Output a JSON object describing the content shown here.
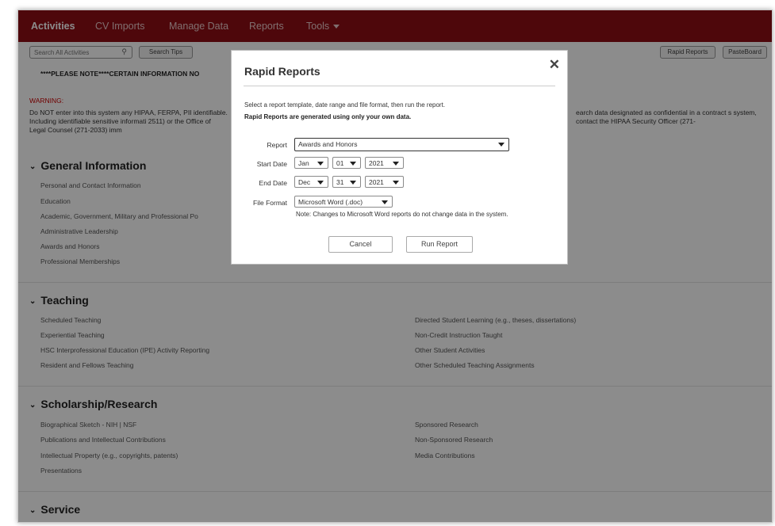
{
  "nav": {
    "items": [
      {
        "label": "Activities",
        "active": true
      },
      {
        "label": "CV Imports",
        "active": false
      },
      {
        "label": "Manage Data",
        "active": false
      },
      {
        "label": "Reports",
        "active": false
      },
      {
        "label": "Tools",
        "active": false
      }
    ]
  },
  "toolbar": {
    "search_placeholder": "Search All Activities",
    "search_tips": "Search Tips",
    "rapid_reports": "Rapid Reports",
    "pasteboard": "PasteBoard"
  },
  "notice": "****PLEASE NOTE****CERTAIN INFORMATION NO",
  "warning": {
    "label": "WARNING:",
    "text_left": "Do NOT enter into this system any HIPAA, FERPA, PII identifiable. Including identifiable sensitive informati 2511) or the Office of Legal Counsel (271-2033) imm",
    "text_right": "earch data designated as confidential in a contract s system, contact the HIPAA Security Officer (271-"
  },
  "sections": {
    "general": {
      "title": "General Information",
      "links": [
        "Personal and Contact Information",
        "Education",
        "Academic, Government, Military and Professional Po",
        "Administrative Leadership",
        "Awards and Honors",
        "Professional Memberships"
      ]
    },
    "teaching": {
      "title": "Teaching",
      "left": [
        "Scheduled Teaching",
        "Experiential Teaching",
        "HSC Interprofessional Education (IPE) Activity Reporting",
        "Resident and Fellows Teaching"
      ],
      "right": [
        "Directed Student Learning (e.g., theses, dissertations)",
        "Non-Credit Instruction Taught",
        "Other Student Activities",
        "Other Scheduled Teaching Assignments"
      ]
    },
    "scholarship": {
      "title": "Scholarship/Research",
      "left": [
        "Biographical Sketch - NIH | NSF",
        "Publications and Intellectual Contributions",
        "Intellectual Property (e.g., copyrights, patents)",
        "Presentations"
      ],
      "right": [
        "Sponsored Research",
        "Non-Sponsored Research",
        "Media Contributions"
      ]
    },
    "service": {
      "title": "Service"
    }
  },
  "modal": {
    "title": "Rapid Reports",
    "close": "✕",
    "desc": "Select a report template, date range and file format, then run the report.",
    "desc_bold": "Rapid Reports are generated using only your own data.",
    "report_label": "Report",
    "report_value": "Awards and Honors",
    "start_label": "Start Date",
    "start": {
      "month": "Jan",
      "day": "01",
      "year": "2021"
    },
    "end_label": "End Date",
    "end": {
      "month": "Dec",
      "day": "31",
      "year": "2021"
    },
    "format_label": "File Format",
    "format_value": "Microsoft Word (.doc)",
    "note": "Note: Changes to Microsoft Word reports do not change data in the system.",
    "cancel": "Cancel",
    "run": "Run Report"
  },
  "colors": {
    "nav_bg": "#8e0e14",
    "warning": "#cc0000"
  }
}
